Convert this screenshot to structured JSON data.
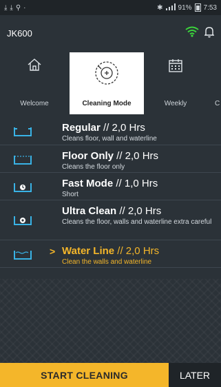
{
  "status_bar": {
    "left_icons": [
      "download-icon",
      "download-icon",
      "usb-icon",
      "dot-icon"
    ],
    "bluetooth": "bluetooth-icon",
    "signal": "signal-icon",
    "battery_percent": "91%",
    "time": "7:53"
  },
  "header": {
    "device_name": "JK600",
    "wifi_color": "#3bd43b"
  },
  "tabs": [
    {
      "label": "Welcome",
      "icon": "home-icon",
      "active": false
    },
    {
      "label": "Cleaning Mode",
      "icon": "cleaning-mode-icon",
      "active": true
    },
    {
      "label": "Weekly",
      "icon": "calendar-icon",
      "active": false
    },
    {
      "label": "C",
      "icon": "",
      "active": false
    }
  ],
  "modes": [
    {
      "title": "Regular",
      "duration": "// 2,0 Hrs",
      "description": "Cleans floor, wall and waterline",
      "icon": "regular-mode-icon",
      "selected": false
    },
    {
      "title": "Floor Only",
      "duration": "// 2,0 Hrs",
      "description": "Cleans the floor only",
      "icon": "floor-only-icon",
      "selected": false
    },
    {
      "title": "Fast Mode",
      "duration": "// 1,0 Hrs",
      "description": "Short",
      "icon": "fast-mode-icon",
      "selected": false
    },
    {
      "title": "Ultra Clean",
      "duration": "// 2,0 Hrs",
      "description": "Cleans the floor, walls and waterline extra careful",
      "icon": "ultra-clean-icon",
      "selected": false
    },
    {
      "title": "Water Line",
      "duration": "// 2,0 Hrs",
      "description": "Clean the walls and waterline",
      "icon": "water-line-icon",
      "selected": true
    }
  ],
  "selected_chevron": ">",
  "buttons": {
    "start": "START CLEANING",
    "later": "LATER"
  },
  "colors": {
    "accent": "#f4b62a",
    "icon_blue": "#39b3e6",
    "background": "#2b3238"
  }
}
